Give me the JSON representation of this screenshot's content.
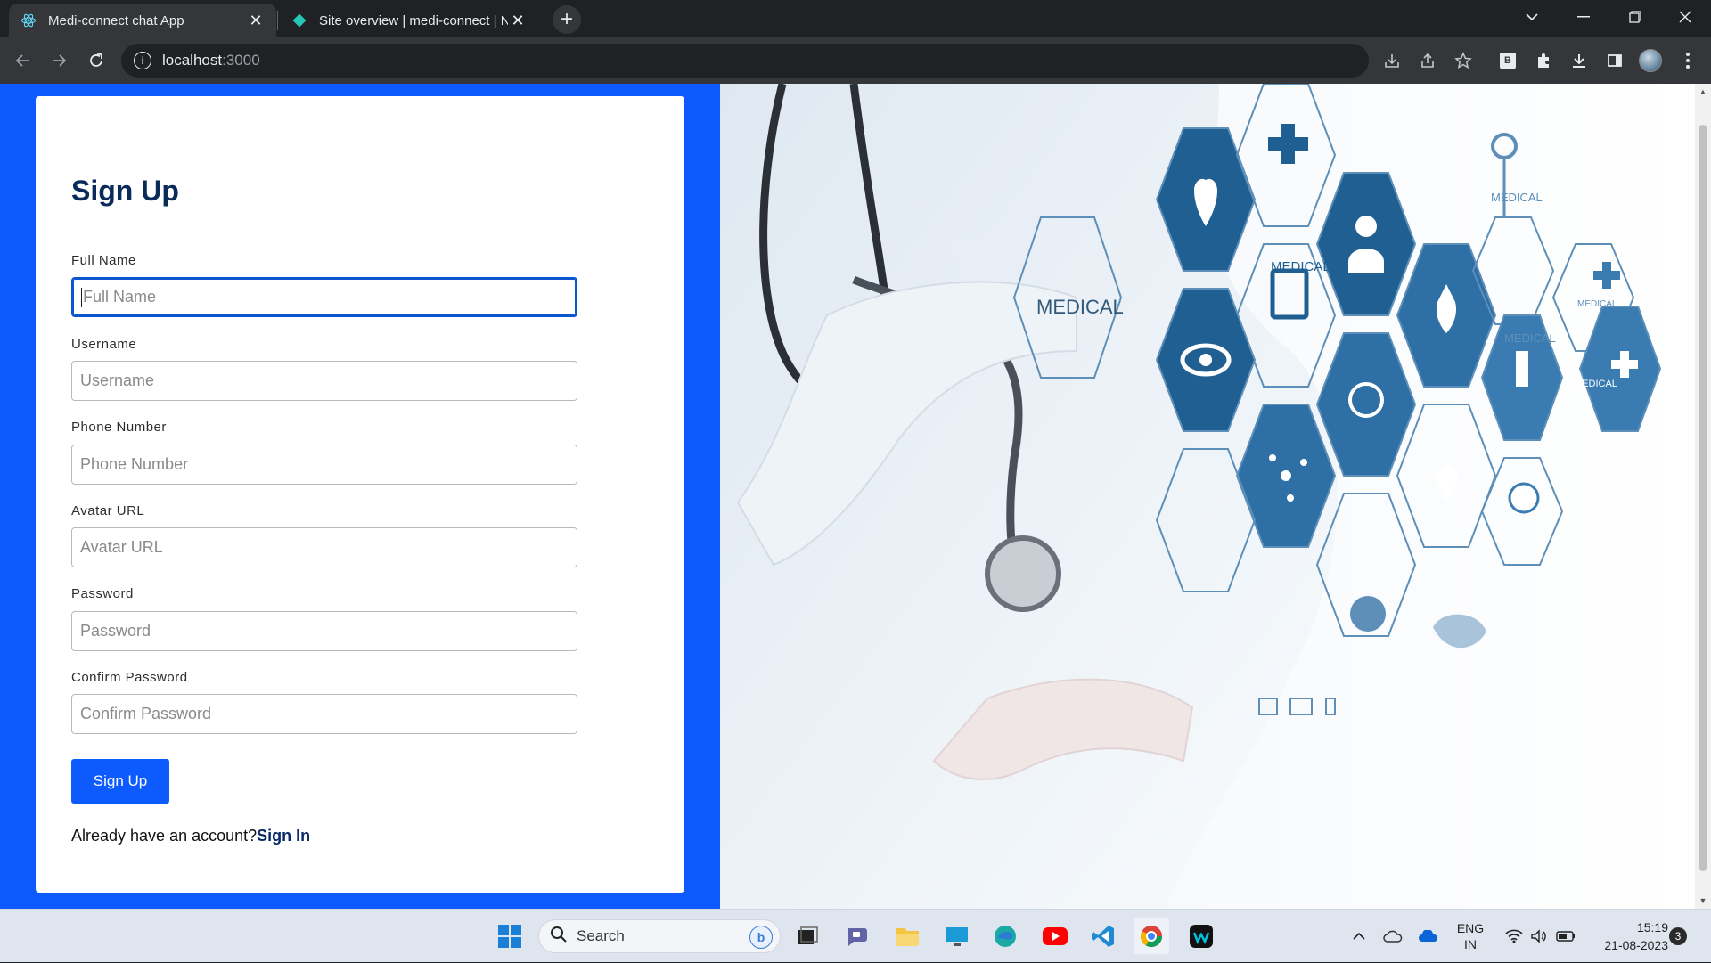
{
  "browser": {
    "tabs": [
      {
        "title": "Medi-connect chat App",
        "icon": "react-icon",
        "active": true
      },
      {
        "title": "Site overview | medi-connect | Ne",
        "icon": "netlify-icon",
        "active": false
      }
    ],
    "new_tab_icon": "plus-icon",
    "url_host": "localhost",
    "url_port": ":3000"
  },
  "form": {
    "title": "Sign Up",
    "fields": [
      {
        "label": "Full Name",
        "placeholder": "Full Name"
      },
      {
        "label": "Username",
        "placeholder": "Username"
      },
      {
        "label": "Phone Number",
        "placeholder": "Phone Number"
      },
      {
        "label": "Avatar URL",
        "placeholder": "Avatar URL"
      },
      {
        "label": "Password",
        "placeholder": "Password"
      },
      {
        "label": "Confirm Password",
        "placeholder": "Confirm Password"
      }
    ],
    "submit_label": "Sign Up",
    "already_text": "Already have an account?",
    "signin_link": "Sign In"
  },
  "hero": {
    "labels": [
      "MEDICAL",
      "MEDICAL",
      "MEDICAL",
      "MEDICAL",
      "MEDICAL",
      "MEDICAL"
    ]
  },
  "taskbar": {
    "search_label": "Search",
    "lang_top": "ENG",
    "lang_bottom": "IN",
    "time": "15:19",
    "date": "21-08-2023",
    "notification_count": "3"
  },
  "colors": {
    "accent_blue": "#0d5bff",
    "title_navy": "#0a2a5a",
    "hex_blue": "#1f5f91"
  }
}
